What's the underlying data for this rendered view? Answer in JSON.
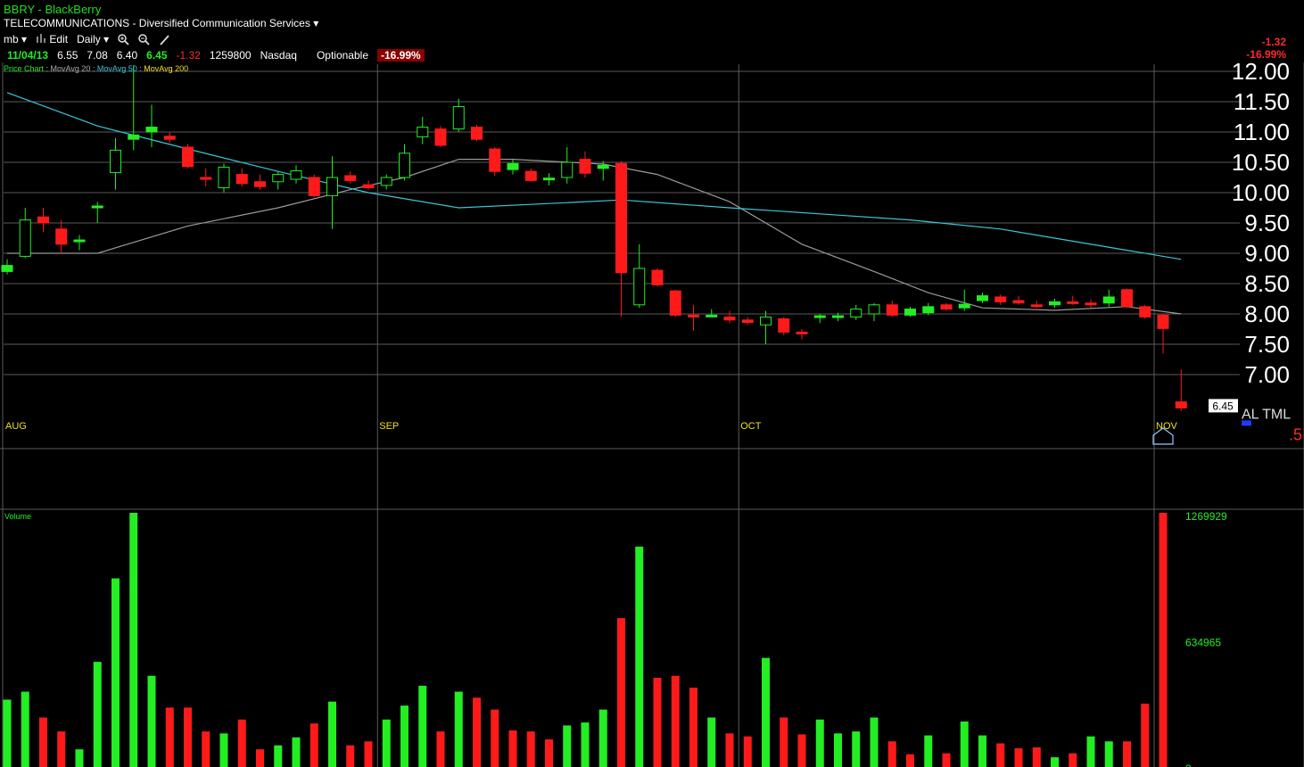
{
  "header": {
    "title": "BBRY - BlackBerry",
    "sector": "TELECOMMUNICATIONS - Diversified Communication Services",
    "sector_caret": "▾",
    "toolbar": {
      "user": "mb",
      "edit_label": "Edit",
      "period_label": "Daily",
      "dropdown_caret": "▾"
    },
    "quote": {
      "date": "11/04/13",
      "open": "6.55",
      "high": "7.08",
      "low": "6.40",
      "last": "6.45",
      "change": "-1.32",
      "volume": "1259800",
      "exchange": "Nasdaq",
      "optionable": "Optionable",
      "change_pct": "-16.99%"
    },
    "legend": {
      "price_chart": "Price Chart",
      "ma20": "MovAvg 20",
      "ma50": "MovAvg 50",
      "ma200": "MovAvg 200"
    },
    "right_change": "-1.32",
    "right_change_pct": "-16.99%"
  },
  "colors": {
    "up": "#22ee22",
    "down": "#ff1a1a",
    "ma20": "#9a9a9a",
    "ma50": "#38c8d8",
    "grid": "#5a5a5a",
    "background": "#000000"
  },
  "chart_data": [
    {
      "type": "candlestick",
      "title": "",
      "y_ticks": [
        "12.00",
        "11.50",
        "11.00",
        "10.50",
        "10.00",
        "9.50",
        "9.00",
        "8.50",
        "8.00",
        "7.50",
        "7.00"
      ],
      "ylim": [
        6.4,
        12.1
      ],
      "x_month_labels": [
        {
          "label": "AUG",
          "index": 0
        },
        {
          "label": "SEP",
          "index": 21
        },
        {
          "label": "OCT",
          "index": 41
        },
        {
          "label": "NOV",
          "index": 64
        }
      ],
      "last_price_label": "6.45",
      "right_edge_labels": [
        "AL TML",
        ".5"
      ],
      "candles": [
        {
          "o": 8.7,
          "h": 8.9,
          "l": 8.65,
          "c": 8.8
        },
        {
          "o": 8.95,
          "h": 9.75,
          "l": 8.92,
          "c": 9.55
        },
        {
          "o": 9.6,
          "h": 9.75,
          "l": 9.35,
          "c": 9.5
        },
        {
          "o": 9.4,
          "h": 9.55,
          "l": 9.0,
          "c": 9.15
        },
        {
          "o": 9.2,
          "h": 9.3,
          "l": 9.05,
          "c": 9.22
        },
        {
          "o": 9.75,
          "h": 9.85,
          "l": 9.5,
          "c": 9.78
        },
        {
          "o": 10.33,
          "h": 10.9,
          "l": 10.05,
          "c": 10.7
        },
        {
          "o": 10.88,
          "h": 12.1,
          "l": 10.7,
          "c": 10.95
        },
        {
          "o": 11.0,
          "h": 11.45,
          "l": 10.75,
          "c": 11.08
        },
        {
          "o": 10.93,
          "h": 11.0,
          "l": 10.82,
          "c": 10.88
        },
        {
          "o": 10.75,
          "h": 10.8,
          "l": 10.4,
          "c": 10.43
        },
        {
          "o": 10.25,
          "h": 10.4,
          "l": 10.1,
          "c": 10.22
        },
        {
          "o": 10.08,
          "h": 10.48,
          "l": 10.0,
          "c": 10.42
        },
        {
          "o": 10.3,
          "h": 10.4,
          "l": 10.1,
          "c": 10.15
        },
        {
          "o": 10.18,
          "h": 10.3,
          "l": 10.05,
          "c": 10.1
        },
        {
          "o": 10.18,
          "h": 10.35,
          "l": 10.05,
          "c": 10.3
        },
        {
          "o": 10.22,
          "h": 10.45,
          "l": 10.15,
          "c": 10.36
        },
        {
          "o": 10.25,
          "h": 10.3,
          "l": 9.92,
          "c": 9.95
        },
        {
          "o": 9.95,
          "h": 10.6,
          "l": 9.4,
          "c": 10.25
        },
        {
          "o": 10.28,
          "h": 10.35,
          "l": 10.15,
          "c": 10.2
        },
        {
          "o": 10.13,
          "h": 10.2,
          "l": 10.05,
          "c": 10.08
        },
        {
          "o": 10.12,
          "h": 10.3,
          "l": 10.05,
          "c": 10.25
        },
        {
          "o": 10.25,
          "h": 10.8,
          "l": 10.2,
          "c": 10.65
        },
        {
          "o": 10.92,
          "h": 11.25,
          "l": 10.8,
          "c": 11.08
        },
        {
          "o": 11.05,
          "h": 11.1,
          "l": 10.75,
          "c": 10.78
        },
        {
          "o": 11.05,
          "h": 11.55,
          "l": 11.0,
          "c": 11.42
        },
        {
          "o": 11.08,
          "h": 11.12,
          "l": 10.85,
          "c": 10.88
        },
        {
          "o": 10.72,
          "h": 10.75,
          "l": 10.28,
          "c": 10.35
        },
        {
          "o": 10.38,
          "h": 10.55,
          "l": 10.3,
          "c": 10.48
        },
        {
          "o": 10.35,
          "h": 10.4,
          "l": 10.18,
          "c": 10.2
        },
        {
          "o": 10.22,
          "h": 10.32,
          "l": 10.12,
          "c": 10.24
        },
        {
          "o": 10.25,
          "h": 10.75,
          "l": 10.15,
          "c": 10.5
        },
        {
          "o": 10.55,
          "h": 10.68,
          "l": 10.25,
          "c": 10.32
        },
        {
          "o": 10.4,
          "h": 10.52,
          "l": 10.2,
          "c": 10.45
        },
        {
          "o": 10.48,
          "h": 10.52,
          "l": 7.95,
          "c": 8.68
        },
        {
          "o": 8.15,
          "h": 9.15,
          "l": 8.1,
          "c": 8.75
        },
        {
          "o": 8.72,
          "h": 8.75,
          "l": 8.45,
          "c": 8.48
        },
        {
          "o": 8.38,
          "h": 8.4,
          "l": 7.95,
          "c": 7.98
        },
        {
          "o": 7.98,
          "h": 8.15,
          "l": 7.72,
          "c": 7.95
        },
        {
          "o": 7.96,
          "h": 8.08,
          "l": 7.95,
          "c": 7.98
        },
        {
          "o": 7.95,
          "h": 8.05,
          "l": 7.85,
          "c": 7.9
        },
        {
          "o": 7.9,
          "h": 7.95,
          "l": 7.82,
          "c": 7.86
        },
        {
          "o": 7.82,
          "h": 8.05,
          "l": 7.5,
          "c": 7.95
        },
        {
          "o": 7.92,
          "h": 7.95,
          "l": 7.65,
          "c": 7.7
        },
        {
          "o": 7.7,
          "h": 7.75,
          "l": 7.58,
          "c": 7.68
        },
        {
          "o": 7.95,
          "h": 8.0,
          "l": 7.85,
          "c": 7.97
        },
        {
          "o": 7.96,
          "h": 8.02,
          "l": 7.88,
          "c": 7.97
        },
        {
          "o": 7.95,
          "h": 8.15,
          "l": 7.9,
          "c": 8.08
        },
        {
          "o": 8.0,
          "h": 8.18,
          "l": 7.88,
          "c": 8.15
        },
        {
          "o": 8.15,
          "h": 8.22,
          "l": 7.95,
          "c": 7.98
        },
        {
          "o": 7.98,
          "h": 8.12,
          "l": 7.95,
          "c": 8.08
        },
        {
          "o": 8.02,
          "h": 8.18,
          "l": 7.98,
          "c": 8.12
        },
        {
          "o": 8.15,
          "h": 8.18,
          "l": 8.05,
          "c": 8.08
        },
        {
          "o": 8.1,
          "h": 8.4,
          "l": 8.05,
          "c": 8.16
        },
        {
          "o": 8.22,
          "h": 8.35,
          "l": 8.18,
          "c": 8.3
        },
        {
          "o": 8.28,
          "h": 8.32,
          "l": 8.15,
          "c": 8.2
        },
        {
          "o": 8.22,
          "h": 8.3,
          "l": 8.15,
          "c": 8.18
        },
        {
          "o": 8.15,
          "h": 8.22,
          "l": 8.1,
          "c": 8.12
        },
        {
          "o": 8.15,
          "h": 8.25,
          "l": 8.1,
          "c": 8.2
        },
        {
          "o": 8.2,
          "h": 8.3,
          "l": 8.15,
          "c": 8.18
        },
        {
          "o": 8.18,
          "h": 8.24,
          "l": 8.1,
          "c": 8.15
        },
        {
          "o": 8.18,
          "h": 8.4,
          "l": 8.12,
          "c": 8.28
        },
        {
          "o": 8.4,
          "h": 8.42,
          "l": 8.1,
          "c": 8.12
        },
        {
          "o": 8.12,
          "h": 8.15,
          "l": 7.92,
          "c": 7.95
        },
        {
          "o": 7.98,
          "h": 8.0,
          "l": 7.35,
          "c": 7.76
        },
        {
          "o": 6.55,
          "h": 7.08,
          "l": 6.4,
          "c": 6.45
        }
      ],
      "moving_averages": [
        {
          "name": "MovAvg 20",
          "color": "#9a9a9a",
          "points": [
            [
              0,
              9.0
            ],
            [
              5,
              9.0
            ],
            [
              10,
              9.45
            ],
            [
              15,
              9.75
            ],
            [
              19,
              10.05
            ],
            [
              22,
              10.25
            ],
            [
              25,
              10.55
            ],
            [
              28,
              10.55
            ],
            [
              33,
              10.47
            ],
            [
              36,
              10.3
            ],
            [
              40,
              9.85
            ],
            [
              44,
              9.15
            ],
            [
              48,
              8.7
            ],
            [
              51,
              8.35
            ],
            [
              54,
              8.1
            ],
            [
              58,
              8.06
            ],
            [
              62,
              8.12
            ],
            [
              65,
              8.0
            ]
          ]
        },
        {
          "name": "MovAvg 50",
          "color": "#38c8d8",
          "points": [
            [
              0,
              11.65
            ],
            [
              5,
              11.1
            ],
            [
              10,
              10.72
            ],
            [
              15,
              10.35
            ],
            [
              20,
              10.0
            ],
            [
              25,
              9.75
            ],
            [
              30,
              9.82
            ],
            [
              34,
              9.88
            ],
            [
              40,
              9.75
            ],
            [
              45,
              9.65
            ],
            [
              50,
              9.55
            ],
            [
              55,
              9.4
            ],
            [
              58,
              9.25
            ],
            [
              62,
              9.05
            ],
            [
              65,
              8.9
            ]
          ]
        }
      ]
    },
    {
      "type": "bar",
      "title": "Volume",
      "y_ticks": [
        "1269929",
        "634965",
        "0"
      ],
      "ylim": [
        0,
        1269929
      ],
      "values": [
        {
          "v": 330000,
          "up": true
        },
        {
          "v": 370000,
          "up": true
        },
        {
          "v": 240000,
          "up": false
        },
        {
          "v": 170000,
          "up": false
        },
        {
          "v": 80000,
          "up": true
        },
        {
          "v": 520000,
          "up": true
        },
        {
          "v": 940000,
          "up": true
        },
        {
          "v": 1269929,
          "up": true
        },
        {
          "v": 450000,
          "up": true
        },
        {
          "v": 290000,
          "up": false
        },
        {
          "v": 290000,
          "up": false
        },
        {
          "v": 170000,
          "up": false
        },
        {
          "v": 160000,
          "up": true
        },
        {
          "v": 230000,
          "up": false
        },
        {
          "v": 80000,
          "up": false
        },
        {
          "v": 100000,
          "up": true
        },
        {
          "v": 140000,
          "up": true
        },
        {
          "v": 210000,
          "up": false
        },
        {
          "v": 320000,
          "up": true
        },
        {
          "v": 100000,
          "up": false
        },
        {
          "v": 120000,
          "up": false
        },
        {
          "v": 230000,
          "up": true
        },
        {
          "v": 300000,
          "up": true
        },
        {
          "v": 400000,
          "up": true
        },
        {
          "v": 170000,
          "up": false
        },
        {
          "v": 370000,
          "up": true
        },
        {
          "v": 340000,
          "up": false
        },
        {
          "v": 280000,
          "up": false
        },
        {
          "v": 175000,
          "up": false
        },
        {
          "v": 170000,
          "up": false
        },
        {
          "v": 130000,
          "up": false
        },
        {
          "v": 200000,
          "up": true
        },
        {
          "v": 215000,
          "up": true
        },
        {
          "v": 280000,
          "up": true
        },
        {
          "v": 740000,
          "up": false
        },
        {
          "v": 1100000,
          "up": true
        },
        {
          "v": 440000,
          "up": false
        },
        {
          "v": 450000,
          "up": false
        },
        {
          "v": 390000,
          "up": false
        },
        {
          "v": 240000,
          "up": true
        },
        {
          "v": 160000,
          "up": false
        },
        {
          "v": 145000,
          "up": false
        },
        {
          "v": 540000,
          "up": true
        },
        {
          "v": 240000,
          "up": false
        },
        {
          "v": 155000,
          "up": false
        },
        {
          "v": 230000,
          "up": true
        },
        {
          "v": 160000,
          "up": true
        },
        {
          "v": 170000,
          "up": true
        },
        {
          "v": 240000,
          "up": true
        },
        {
          "v": 120000,
          "up": false
        },
        {
          "v": 55000,
          "up": false
        },
        {
          "v": 150000,
          "up": true
        },
        {
          "v": 60000,
          "up": false
        },
        {
          "v": 220000,
          "up": true
        },
        {
          "v": 150000,
          "up": true
        },
        {
          "v": 110000,
          "up": false
        },
        {
          "v": 85000,
          "up": false
        },
        {
          "v": 90000,
          "up": false
        },
        {
          "v": 40000,
          "up": true
        },
        {
          "v": 60000,
          "up": false
        },
        {
          "v": 145000,
          "up": true
        },
        {
          "v": 120000,
          "up": true
        },
        {
          "v": 120000,
          "up": false
        },
        {
          "v": 310000,
          "up": false
        },
        {
          "v": 1269929,
          "up": false
        }
      ]
    }
  ]
}
